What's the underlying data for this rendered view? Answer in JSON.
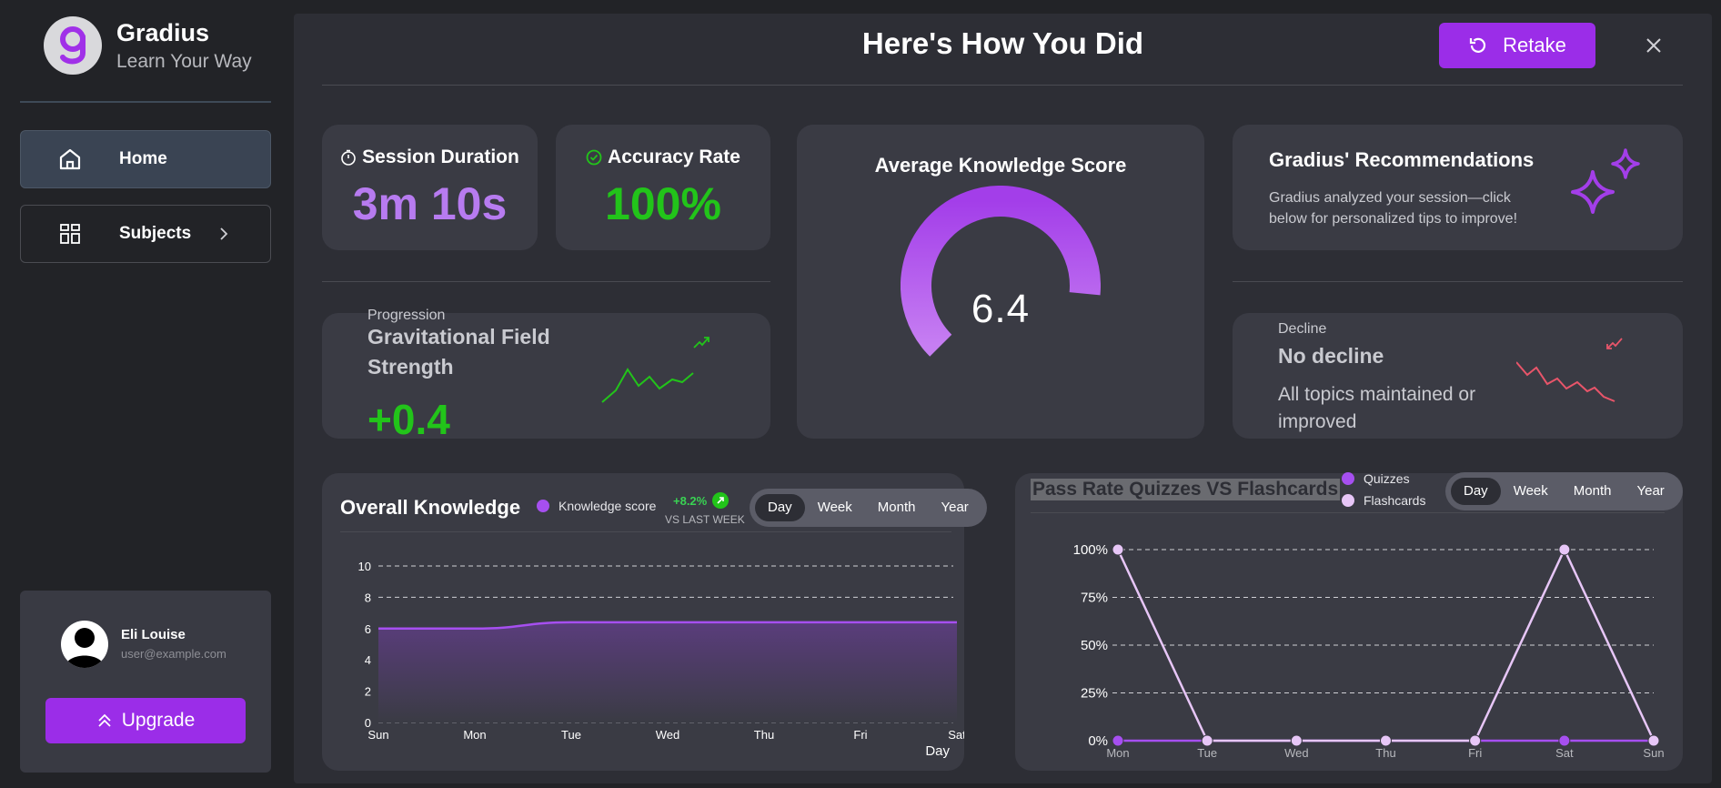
{
  "brand": {
    "name": "Gradius",
    "tagline": "Learn Your Way"
  },
  "sidebar": {
    "items": [
      {
        "label": "Home",
        "icon": "home-icon",
        "active": true
      },
      {
        "label": "Subjects",
        "icon": "grid-icon",
        "active": false
      }
    ]
  },
  "user": {
    "name": "Eli Louise",
    "email": "user@example.com",
    "upgrade_label": "Upgrade"
  },
  "header": {
    "title": "Here's How You Did",
    "retake_label": "Retake"
  },
  "stats": {
    "session_duration": {
      "label": "Session Duration",
      "value": "3m 10s"
    },
    "accuracy": {
      "label": "Accuracy Rate",
      "value": "100%"
    }
  },
  "progression": {
    "caption": "Progression",
    "topic_line1": "Gravitational Field",
    "topic_line2": "Strength",
    "delta": "+0.4"
  },
  "knowledge_score": {
    "title": "Average Knowledge Score",
    "value": "6.4",
    "fraction": 0.64
  },
  "recommendations": {
    "title": "Gradius' Recommendations",
    "description": "Gradius analyzed your session—click below for personalized tips to improve!"
  },
  "decline": {
    "caption": "Decline",
    "title": "No decline",
    "line1": "All topics maintained or",
    "line2": "improved"
  },
  "overall": {
    "title": "Overall Knowledge",
    "legend": "Knowledge score",
    "change": "+8.2%",
    "change_caption": "VS LAST WEEK",
    "ranges": [
      "Day",
      "Week",
      "Month",
      "Year"
    ],
    "active_range": "Day"
  },
  "pass_rate": {
    "title": "Pass Rate Quizzes VS Flashcards",
    "legend_quizzes": "Quizzes",
    "legend_flashcards": "Flashcards",
    "ranges": [
      "Day",
      "Week",
      "Month",
      "Year"
    ],
    "active_range": "Day"
  },
  "colors": {
    "accent": "#9b2de8",
    "positive": "#22c41a",
    "stat_purple": "#b77bf0",
    "decline": "#e8556a",
    "flashcards": "#e7c6f7"
  },
  "chart_data": [
    {
      "type": "area",
      "title": "Overall Knowledge",
      "xlabel": "Day",
      "ylabel": "",
      "categories": [
        "Sun",
        "Mon",
        "Tue",
        "Wed",
        "Thu",
        "Fri",
        "Sat"
      ],
      "series": [
        {
          "name": "Knowledge score",
          "values": [
            6.0,
            6.0,
            6.4,
            6.4,
            6.4,
            6.4,
            6.4
          ]
        }
      ],
      "ylim": [
        0,
        10
      ],
      "yticks": [
        0,
        2,
        4,
        6,
        8,
        10
      ],
      "grid": true
    },
    {
      "type": "line",
      "title": "Pass Rate Quizzes VS Flashcards",
      "categories": [
        "Mon",
        "Tue",
        "Wed",
        "Thu",
        "Fri",
        "Sat",
        "Sun"
      ],
      "series": [
        {
          "name": "Quizzes",
          "values": [
            0,
            0,
            0,
            0,
            0,
            0,
            0
          ]
        },
        {
          "name": "Flashcards",
          "values": [
            100,
            0,
            0,
            0,
            0,
            100,
            0
          ]
        }
      ],
      "ylim": [
        0,
        100
      ],
      "yticks": [
        "0%",
        "25%",
        "50%",
        "75%",
        "100%"
      ],
      "grid": true,
      "legend": "top"
    }
  ]
}
